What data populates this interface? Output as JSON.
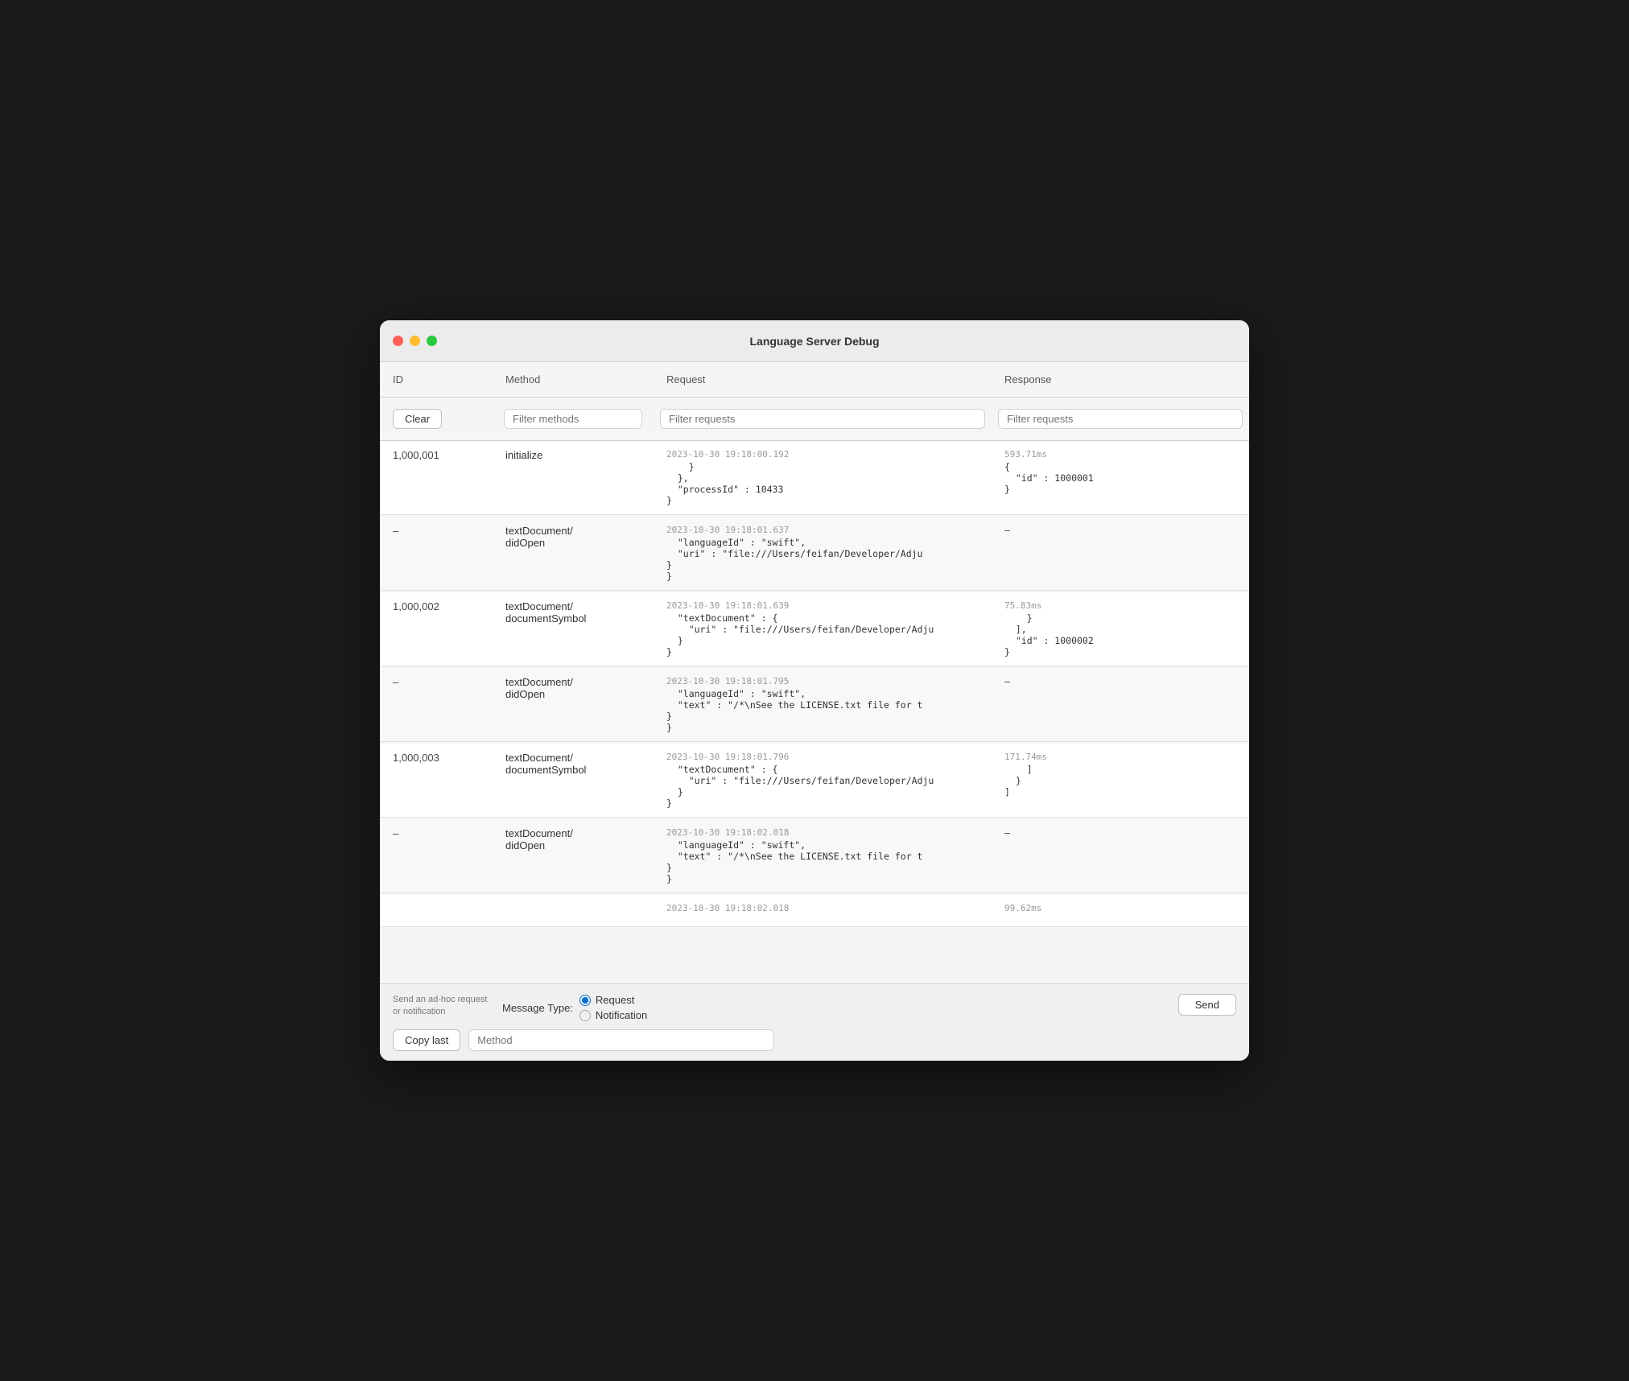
{
  "window": {
    "title": "Language Server Debug"
  },
  "table": {
    "columns": [
      "ID",
      "Method",
      "Request",
      "Response"
    ],
    "filters": {
      "clear_label": "Clear",
      "method_placeholder": "Filter methods",
      "request_placeholder": "Filter requests",
      "response_placeholder": "Filter requests"
    },
    "rows": [
      {
        "id": "1,000,001",
        "method": "initialize",
        "request_timestamp": "2023-10-30 19:18:00.192",
        "request_body": "    }\n  },\n  \"processId\" : 10433\n}",
        "response_timing": "593.71ms",
        "response_body": "{\n  \"id\" : 1000001\n}"
      },
      {
        "id": "–",
        "method": "textDocument/\ndidOpen",
        "request_timestamp": "2023-10-30 19:18:01.637",
        "request_body": "  \"languageId\" : \"swift\",\n  \"uri\" : \"file:///Users/feifan/Developer/Adju\n}\n}",
        "response_timing": "",
        "response_body": "–"
      },
      {
        "id": "1,000,002",
        "method": "textDocument/\ndocumentSymbol",
        "request_timestamp": "2023-10-30 19:18:01.639",
        "request_body": "  \"textDocument\" : {\n    \"uri\" : \"file:///Users/feifan/Developer/Adju\n  }\n}",
        "response_timing": "75.83ms",
        "response_body": "    }\n  ],\n  \"id\" : 1000002\n}"
      },
      {
        "id": "–",
        "method": "textDocument/\ndidOpen",
        "request_timestamp": "2023-10-30 19:18:01.795",
        "request_body": "  \"languageId\" : \"swift\",\n  \"text\" : \"/*\\nSee the LICENSE.txt file for t\n}\n}",
        "response_timing": "",
        "response_body": "–"
      },
      {
        "id": "1,000,003",
        "method": "textDocument/\ndocumentSymbol",
        "request_timestamp": "2023-10-30 19:18:01.796",
        "request_body": "  \"textDocument\" : {\n    \"uri\" : \"file:///Users/feifan/Developer/Adju\n  }\n}",
        "response_timing": "171.74ms",
        "response_body": "    ]\n  }\n]"
      },
      {
        "id": "–",
        "method": "textDocument/\ndidOpen",
        "request_timestamp": "2023-10-30 19:18:02.018",
        "request_body": "  \"languageId\" : \"swift\",\n  \"text\" : \"/*\\nSee the LICENSE.txt file for t\n}\n}",
        "response_timing": "",
        "response_body": "–"
      },
      {
        "id": "",
        "method": "",
        "request_timestamp": "2023-10-30 19:18:02.018",
        "request_body": "",
        "response_timing": "99.62ms",
        "response_body": ""
      }
    ]
  },
  "bottom_bar": {
    "hint": "Send an ad-hoc request or notification",
    "message_type_label": "Message Type:",
    "message_types": [
      "Request",
      "Notification"
    ],
    "selected_message_type": "Request",
    "copy_last_label": "Copy last",
    "method_placeholder": "Method",
    "send_label": "Send"
  }
}
